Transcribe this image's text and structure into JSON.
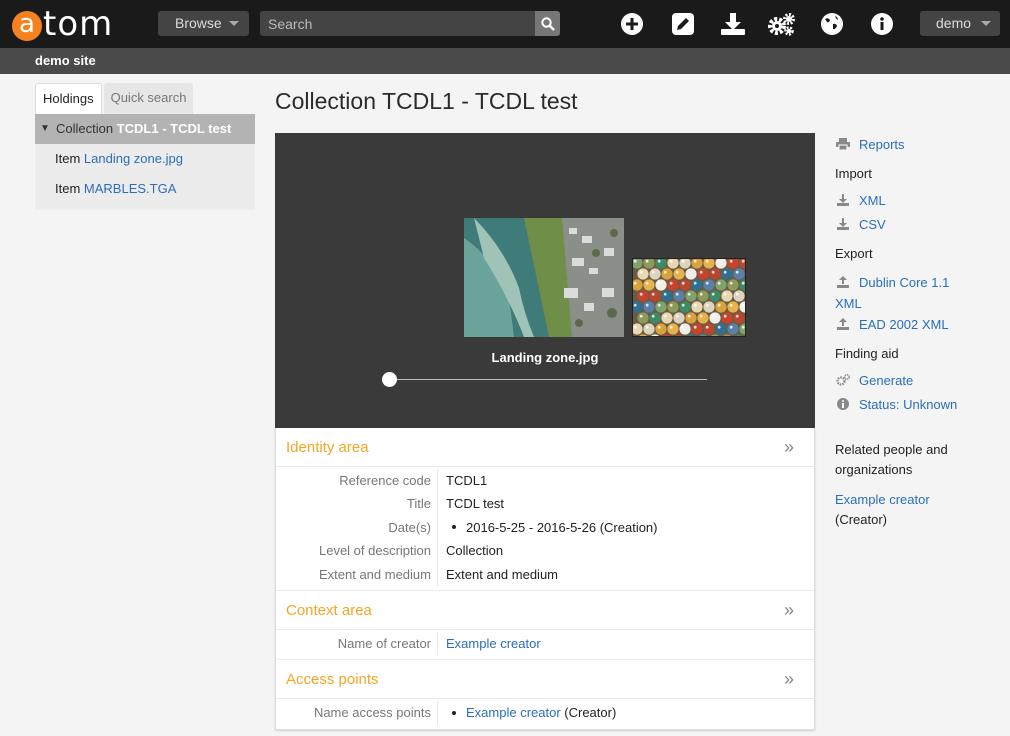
{
  "header": {
    "logo_a": "a",
    "logo_tom": "tom",
    "browse_label": "Browse",
    "search_placeholder": "Search",
    "user_label": "demo",
    "icons": [
      "plus-circle-icon",
      "edit-icon",
      "download-icon",
      "gears-icon",
      "globe-icon",
      "info-icon"
    ]
  },
  "site": {
    "name": "demo site"
  },
  "sidebar": {
    "tabs": [
      {
        "label": "Holdings"
      },
      {
        "label": "Quick search"
      }
    ],
    "tree": [
      {
        "type": "Collection",
        "title": "TCDL1 - TCDL test"
      },
      {
        "type": "Item",
        "title": "Landing zone.jpg"
      },
      {
        "type": "Item",
        "title": "MARBLES.TGA"
      }
    ]
  },
  "main": {
    "title": "Collection TCDL1 - TCDL test",
    "viewer": {
      "caption": "Landing zone.jpg",
      "slider_position": 0
    },
    "sections": {
      "identity": {
        "title": "Identity area",
        "arrow": "»",
        "fields": [
          {
            "label": "Reference code",
            "value": "TCDL1"
          },
          {
            "label": "Title",
            "value": "TCDL test"
          },
          {
            "label": "Date(s)",
            "value": "2016-5-25 - 2016-5-26 (Creation)"
          },
          {
            "label": "Level of description",
            "value": "Collection"
          },
          {
            "label": "Extent and medium",
            "value": "Extent and medium"
          }
        ]
      },
      "context": {
        "title": "Context area",
        "arrow": "»",
        "fields": [
          {
            "label": "Name of creator",
            "value": "Example creator"
          }
        ]
      },
      "access": {
        "title": "Access points",
        "arrow": "»",
        "fields": [
          {
            "label": "Name access points",
            "value": "Example creator",
            "suffix": "(Creator)"
          }
        ]
      }
    }
  },
  "right_sidebar": {
    "reports": "Reports",
    "import_heading": "Import",
    "import_xml": "XML",
    "import_csv": "CSV",
    "export_heading": "Export",
    "export_dc_line1": "Dublin Core 1.1",
    "export_dc_line2": "XML",
    "export_ead": "EAD 2002 XML",
    "finding_aid_heading": "Finding aid",
    "generate": "Generate",
    "status": "Status: Unknown",
    "related_heading_line1": "Related people and",
    "related_heading_line2": "organizations",
    "related_name": "Example creator",
    "related_role": "(Creator)"
  },
  "colors": {
    "accent_orange": "#f5a623",
    "logo_orange": "#f5821f",
    "link_blue": "#2a6ebb",
    "header_bg": "#1a1a1a"
  }
}
